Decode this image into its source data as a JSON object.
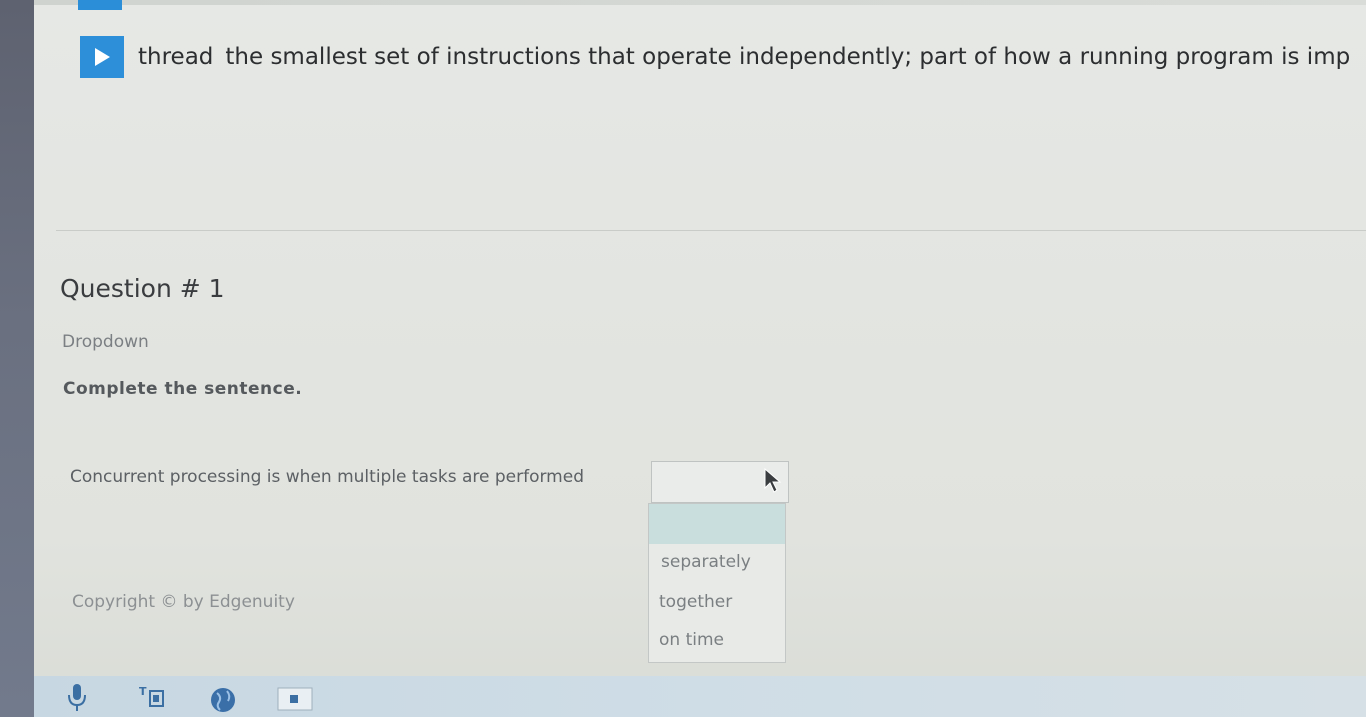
{
  "term": {
    "word": "thread",
    "definition": "the smallest set of instructions that operate independently; part of how a running program is imp"
  },
  "question": {
    "title": "Question # 1",
    "type": "Dropdown",
    "instruction": "Complete the sentence.",
    "sentence": "Concurrent processing is when multiple tasks are performed"
  },
  "dropdown": {
    "selected": "",
    "options": [
      "",
      "separately",
      "together",
      "on time"
    ]
  },
  "footer": {
    "copyright": "Copyright © by Edgenuity"
  },
  "colors": {
    "accent": "#2d8fd9",
    "highlight": "#c9dedd"
  },
  "toolbar": {
    "icons": [
      "microphone-icon",
      "translate-icon",
      "globe-icon",
      "keyboard-icon"
    ]
  }
}
